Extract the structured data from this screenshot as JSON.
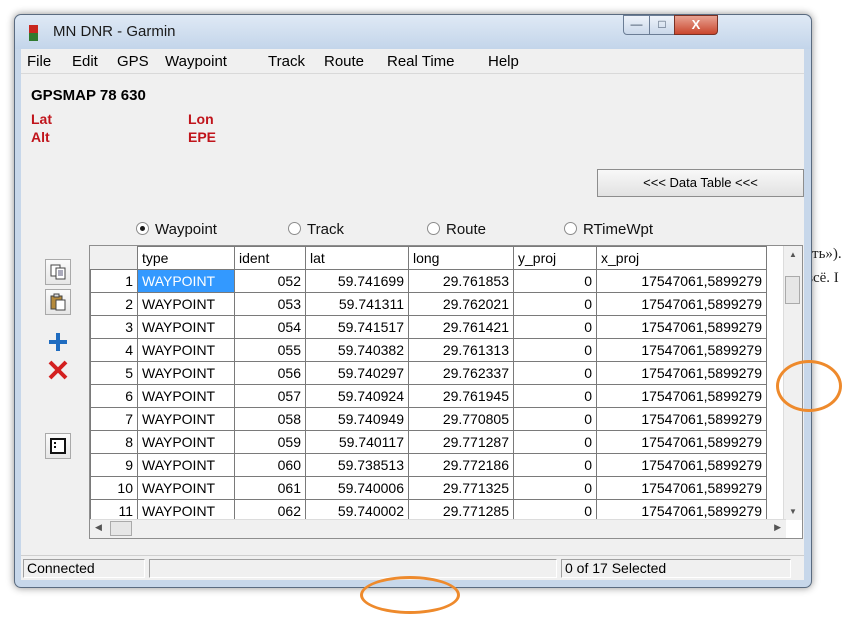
{
  "window": {
    "title": "MN DNR - Garmin"
  },
  "menu": [
    "File",
    "Edit",
    "GPS",
    "Waypoint",
    "Track",
    "Route",
    "Real Time",
    "Help"
  ],
  "device": {
    "name": "GPSMAP 78  630",
    "lat_label": "Lat",
    "lon_label": "Lon",
    "alt_label": "Alt",
    "epe_label": "EPE"
  },
  "data_table_button": "<<< Data Table <<<",
  "radio_options": [
    {
      "label": "Waypoint",
      "selected": true
    },
    {
      "label": "Track",
      "selected": false
    },
    {
      "label": "Route",
      "selected": false
    },
    {
      "label": "RTimeWpt",
      "selected": false
    }
  ],
  "toolbar_icons": [
    "copy-icon",
    "paste-icon",
    "add-icon",
    "delete-icon",
    "properties-icon"
  ],
  "table": {
    "columns": [
      "type",
      "ident",
      "lat",
      "long",
      "y_proj",
      "x_proj"
    ],
    "rows": [
      [
        "1",
        "WAYPOINT",
        "052",
        "59.741699",
        "29.761853",
        "0",
        "17547061,5899279"
      ],
      [
        "2",
        "WAYPOINT",
        "053",
        "59.741311",
        "29.762021",
        "0",
        "17547061,5899279"
      ],
      [
        "3",
        "WAYPOINT",
        "054",
        "59.741517",
        "29.761421",
        "0",
        "17547061,5899279"
      ],
      [
        "4",
        "WAYPOINT",
        "055",
        "59.740382",
        "29.761313",
        "0",
        "17547061,5899279"
      ],
      [
        "5",
        "WAYPOINT",
        "056",
        "59.740297",
        "29.762337",
        "0",
        "17547061,5899279"
      ],
      [
        "6",
        "WAYPOINT",
        "057",
        "59.740924",
        "29.761945",
        "0",
        "17547061,5899279"
      ],
      [
        "7",
        "WAYPOINT",
        "058",
        "59.740949",
        "29.770805",
        "0",
        "17547061,5899279"
      ],
      [
        "8",
        "WAYPOINT",
        "059",
        "59.740117",
        "29.771287",
        "0",
        "17547061,5899279"
      ],
      [
        "9",
        "WAYPOINT",
        "060",
        "59.738513",
        "29.772186",
        "0",
        "17547061,5899279"
      ],
      [
        "10",
        "WAYPOINT",
        "061",
        "59.740006",
        "29.771325",
        "0",
        "17547061,5899279"
      ],
      [
        "11",
        "WAYPOINT",
        "062",
        "59.740002",
        "29.771285",
        "0",
        "17547061,5899279"
      ]
    ]
  },
  "status": {
    "left": "Connected",
    "middle": "",
    "right": "0 of 17 Selected"
  },
  "background_text": {
    "line1": "ить»).",
    "line2": "всё. I"
  },
  "colors": {
    "selection": "#3399ff",
    "label_red": "#c0141b",
    "annotation": "#ee8a2c"
  }
}
